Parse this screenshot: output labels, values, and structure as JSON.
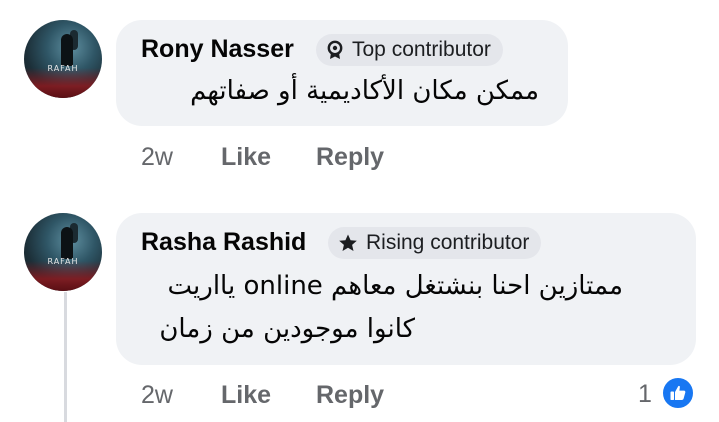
{
  "comments": [
    {
      "author": "Rony Nasser",
      "badge": "Top contributor",
      "badge_icon": "top-contributor-badge-icon",
      "avatar_text": "RAFAH",
      "text_lines": [
        "ممكن مكان  الأكاديمية أو صفاتهم"
      ],
      "time": "2w",
      "like_label": "Like",
      "reply_label": "Reply"
    },
    {
      "author": "Rasha Rashid",
      "badge": "Rising contributor",
      "badge_icon": "star-icon",
      "avatar_text": "RAFAH",
      "text_lines": [
        "ممتازين احنا بنشتغل معاهم online يااريت",
        "كانوا موجودين من زمان"
      ],
      "time": "2w",
      "like_label": "Like",
      "reply_label": "Reply",
      "reaction_count": "1",
      "reaction_icon": "like-reaction-icon"
    }
  ],
  "colors": {
    "bubble": "#f0f2f5",
    "badge_bg": "#e4e6eb",
    "meta_text": "#65676b",
    "like_blue": "#1877f2"
  }
}
